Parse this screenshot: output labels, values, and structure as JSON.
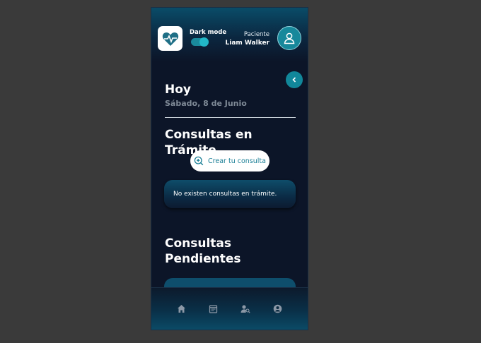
{
  "header": {
    "dark_mode_label": "Dark mode",
    "dark_mode_on": true,
    "user_role": "Paciente",
    "user_name": "Liam Walker"
  },
  "today": {
    "title": "Hoy",
    "date": "Sábado, 8 de Junio"
  },
  "in_progress": {
    "title": "Consultas en Trámite",
    "create_button": "Crear tu consulta",
    "empty_message": "No existen consultas en trámite."
  },
  "pending": {
    "title_line1": "Consultas",
    "title_line2": "Pendientes"
  },
  "nav": {
    "items": [
      "home-icon",
      "calendar-icon",
      "search-doctor-icon",
      "profile-icon"
    ]
  },
  "colors": {
    "accent": "#11879a",
    "background": "#0c1528",
    "outer": "#3a3a3a"
  }
}
